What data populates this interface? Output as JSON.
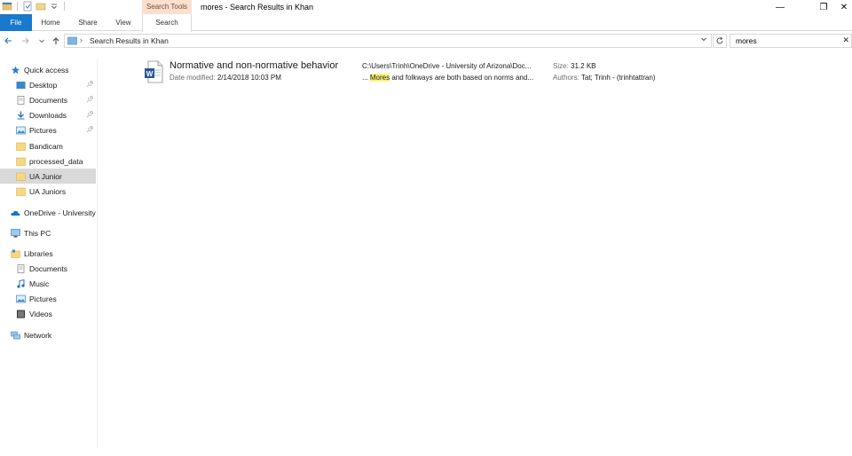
{
  "window": {
    "title": "mores - Search Results in Khan",
    "minimize": "—",
    "restore": "❐",
    "close": "✕"
  },
  "ribbon": {
    "contextual_label": "Search Tools",
    "tabs": [
      {
        "label": "File"
      },
      {
        "label": "Home"
      },
      {
        "label": "Share"
      },
      {
        "label": "View"
      },
      {
        "label": "Search"
      }
    ]
  },
  "address": {
    "path": "Search Results in Khan",
    "search_value": "mores"
  },
  "nav": {
    "items": [
      {
        "label": "Quick access",
        "icon": "star-icon"
      },
      {
        "label": "Desktop",
        "icon": "desktop-icon",
        "pinned": true
      },
      {
        "label": "Documents",
        "icon": "documents-icon",
        "pinned": true
      },
      {
        "label": "Downloads",
        "icon": "downloads-icon",
        "pinned": true
      },
      {
        "label": "Pictures",
        "icon": "pictures-icon",
        "pinned": true
      },
      {
        "label": "Bandicam",
        "icon": "folder-icon"
      },
      {
        "label": "processed_data",
        "icon": "folder-icon"
      },
      {
        "label": "UA Junior",
        "icon": "folder-icon",
        "selected": true
      },
      {
        "label": "UA Juniors",
        "icon": "folder-icon"
      },
      {
        "label": "OneDrive - University",
        "icon": "onedrive-icon"
      },
      {
        "label": "This PC",
        "icon": "computer-icon"
      },
      {
        "label": "Libraries",
        "icon": "libraries-icon"
      },
      {
        "label": "Documents",
        "icon": "documents-icon"
      },
      {
        "label": "Music",
        "icon": "music-icon"
      },
      {
        "label": "Pictures",
        "icon": "pictures-icon"
      },
      {
        "label": "Videos",
        "icon": "videos-icon"
      },
      {
        "label": "Network",
        "icon": "network-icon"
      }
    ]
  },
  "result": {
    "title": "Normative and non-normative behavior",
    "date_label": "Date modified:",
    "date_value": "2/14/2018 10:03 PM",
    "path": "C:\\Users\\Trinh\\OneDrive - University of Arizona\\Doc...",
    "snippet_prefix": "... ",
    "snippet_match": "Mores",
    "snippet_rest": " and folkways are both based on norms and...",
    "size_label": "Size:",
    "size_value": "31.2 KB",
    "authors_label": "Authors:",
    "authors_value": "Tat; Trinh - (trinhtattran)"
  },
  "colors": {
    "file_tab": "#1979ca",
    "contextual_tab": "#fbe0d0",
    "highlight": "#fff27a",
    "selected_nav": "#d9d9d9"
  }
}
